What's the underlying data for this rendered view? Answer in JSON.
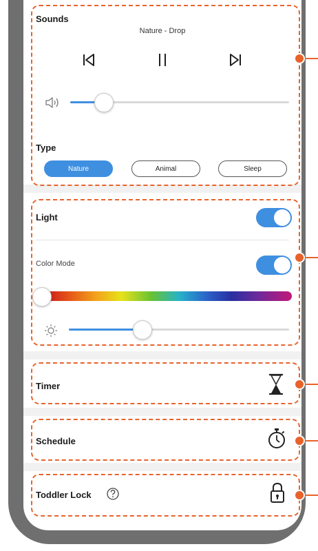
{
  "sounds": {
    "title": "Sounds",
    "now_playing": "Nature - Drop",
    "volume_level": 0.15,
    "type_label": "Type",
    "types": [
      {
        "label": "Nature",
        "active": true
      },
      {
        "label": "Animal",
        "active": false
      },
      {
        "label": "Sleep",
        "active": false
      }
    ]
  },
  "light": {
    "label": "Light",
    "on": true,
    "color_mode_label": "Color Mode",
    "color_mode_on": true,
    "color_position": 0.0,
    "brightness_level": 0.33
  },
  "timer": {
    "label": "Timer",
    "icon": "hourglass-icon"
  },
  "schedule": {
    "label": "Schedule",
    "icon": "stopwatch-icon"
  },
  "toddler_lock": {
    "label": "Toddler Lock",
    "help_icon": "help-icon",
    "icon": "lock-icon"
  },
  "colors": {
    "accent": "#3f8fe0",
    "callout": "#e8622b",
    "frame": "#6f6f6f"
  }
}
